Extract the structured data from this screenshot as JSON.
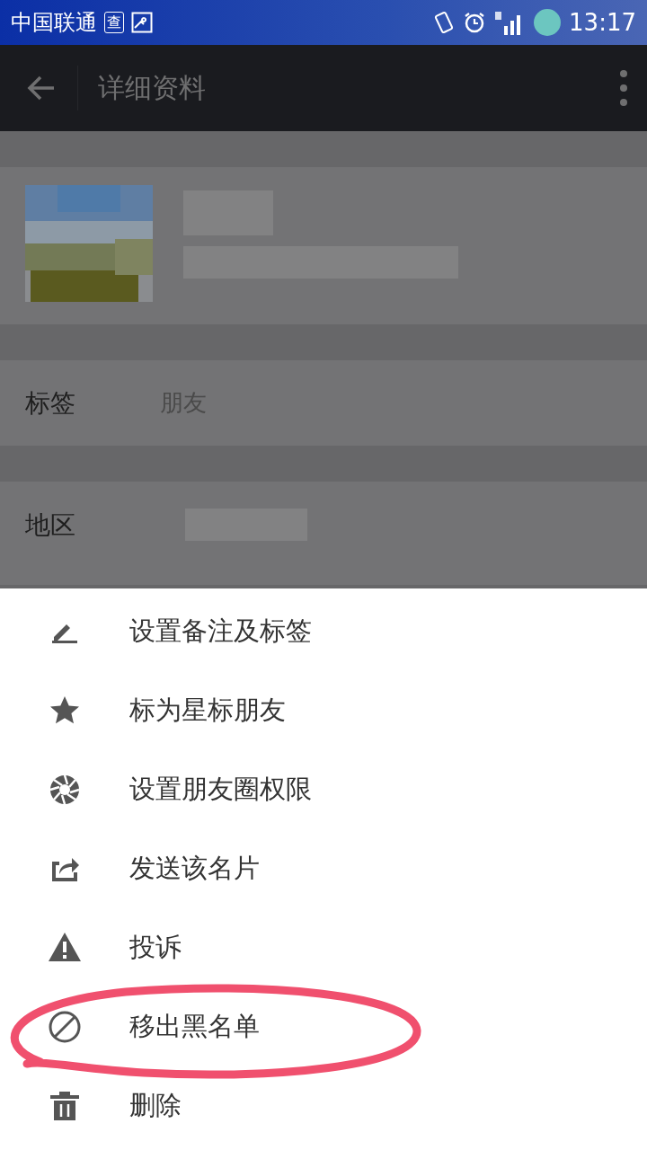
{
  "status_bar": {
    "carrier": "中国联通",
    "badge": "查",
    "time": "13:17"
  },
  "app_bar": {
    "title": "详细资料"
  },
  "fields": [
    {
      "label": "标签",
      "value": "朋友"
    },
    {
      "label": "地区"
    }
  ],
  "menu": [
    {
      "kind": "edit",
      "label": "设置备注及标签"
    },
    {
      "kind": "star",
      "label": "标为星标朋友"
    },
    {
      "kind": "moments",
      "label": "设置朋友圈权限"
    },
    {
      "kind": "share",
      "label": "发送该名片"
    },
    {
      "kind": "report",
      "label": "投诉"
    },
    {
      "kind": "unblock",
      "label": "移出黑名单",
      "highlighted": true
    },
    {
      "kind": "delete",
      "label": "删除"
    }
  ]
}
